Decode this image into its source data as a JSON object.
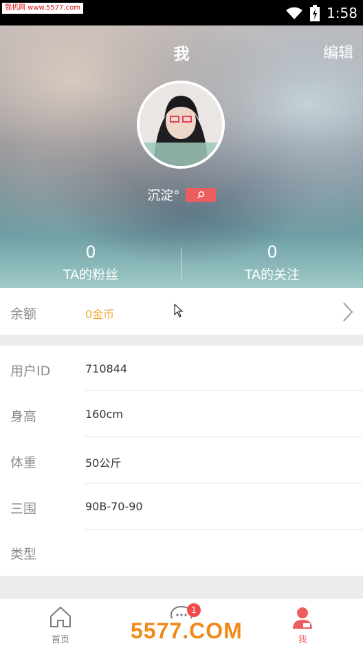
{
  "status_bar": {
    "watermark": "我机网 www.5577.com",
    "time": "1:58"
  },
  "header": {
    "title": "我",
    "edit_label": "编辑"
  },
  "profile": {
    "nickname": "沉淀°",
    "followers_count": "0",
    "followers_label": "TA的粉丝",
    "following_count": "0",
    "following_label": "TA的关注"
  },
  "balance": {
    "label": "余额",
    "value": "0金币"
  },
  "info_rows": [
    {
      "label": "用户ID",
      "value": "710844"
    },
    {
      "label": "身高",
      "value": "160cm"
    },
    {
      "label": "体重",
      "value": "50公斤"
    },
    {
      "label": "三围",
      "value": "90B-70-90"
    },
    {
      "label": "类型",
      "value": ""
    }
  ],
  "tabbar": {
    "tabs": [
      {
        "label": "首页",
        "icon": "home-icon"
      },
      {
        "label": "",
        "icon": "chat-icon",
        "badge": "1"
      },
      {
        "label": "我",
        "icon": "person-icon"
      }
    ]
  },
  "bottom_watermark": "5577.COM",
  "colors": {
    "accent": "#ee5d5d",
    "gold": "#f0a830",
    "tab_active": "#ee5d5d",
    "tab_inactive": "#7a7a7a"
  }
}
